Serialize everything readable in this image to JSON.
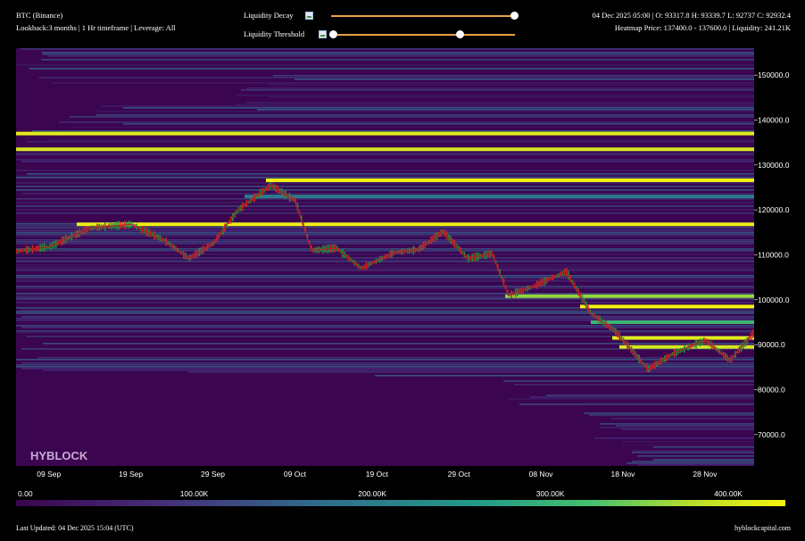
{
  "header": {
    "symbol": "BTC (Binance)",
    "settings": "Lookback:3 months | 1 Hr timeframe | Leverage: All",
    "ohlc": "04 Dec 2025 05:00 | O: 93317.8 H: 93339.7 L: 92737 C: 92932.4",
    "heatmap_info": "Heatmap Price: 137400.0 - 137600.0 | Liquidity: 241.21K"
  },
  "controls": {
    "decay_label": "Liquidity Decay",
    "decay_value": 1.0,
    "threshold_label": "Liquidity Threshold",
    "threshold_range": [
      0.0,
      0.7
    ]
  },
  "colorscale": {
    "labels": [
      "0.00",
      "100.00K",
      "200.00K",
      "300.00K",
      "400.00K"
    ],
    "stops": [
      "#3b0550",
      "#46307a",
      "#2f6e8c",
      "#229a87",
      "#47c16d",
      "#b9de2c",
      "#f4f20f"
    ]
  },
  "footer": {
    "updated": "Last Updated: 04 Dec 2025 15:04 (UTC)",
    "site": "hyblockcapital.com"
  },
  "watermark": "HYBLOCK",
  "colors": {
    "background_low": "#3b0550",
    "candle_up": "#2d8a3a",
    "candle_down": "#c62828",
    "accent": "#e8a047"
  },
  "chart_data": {
    "type": "heatmap",
    "title": "",
    "xlabel": "",
    "ylabel": "",
    "x_tick_labels": [
      "09 Sep",
      "19 Sep",
      "29 Sep",
      "09 Oct",
      "19 Oct",
      "29 Oct",
      "08 Nov",
      "18 Nov",
      "28 Nov"
    ],
    "y_tick_labels": [
      "150000.0",
      "140000.0",
      "130000.0",
      "120000.0",
      "110000.0",
      "100000.0",
      "90000.0",
      "80000.0",
      "70000.0"
    ],
    "y_ticks": [
      150000,
      140000,
      130000,
      120000,
      110000,
      100000,
      90000,
      80000,
      70000
    ],
    "ylim": [
      63000,
      156000
    ],
    "x_dates": [
      "2025-09-05",
      "2025-09-09",
      "2025-09-14",
      "2025-09-19",
      "2025-09-23",
      "2025-09-26",
      "2025-09-29",
      "2025-10-02",
      "2025-10-06",
      "2025-10-09",
      "2025-10-11",
      "2025-10-14",
      "2025-10-17",
      "2025-10-21",
      "2025-10-24",
      "2025-10-27",
      "2025-10-30",
      "2025-11-02",
      "2025-11-04",
      "2025-11-07",
      "2025-11-11",
      "2025-11-14",
      "2025-11-17",
      "2025-11-21",
      "2025-11-24",
      "2025-11-28",
      "2025-12-01",
      "2025-12-04"
    ],
    "price_close": [
      110800,
      111800,
      116000,
      116800,
      113200,
      109200,
      112600,
      120000,
      125500,
      122000,
      111000,
      111500,
      107000,
      110500,
      111200,
      115200,
      109200,
      110300,
      101000,
      103000,
      106300,
      97000,
      93000,
      84500,
      88000,
      91000,
      86500,
      92900
    ],
    "liquidity_bands": [
      {
        "price": 137000,
        "value": 400000
      },
      {
        "price": 133500,
        "value": 380000
      },
      {
        "price": 126600,
        "value": 420000
      },
      {
        "price": 116800,
        "value": 410000
      },
      {
        "price": 100800,
        "value": 330000
      },
      {
        "price": 98500,
        "value": 420000
      },
      {
        "price": 91500,
        "value": 400000
      },
      {
        "price": 89500,
        "value": 380000
      },
      {
        "price": 95000,
        "value": 260000
      },
      {
        "price": 123000,
        "value": 160000
      }
    ]
  }
}
